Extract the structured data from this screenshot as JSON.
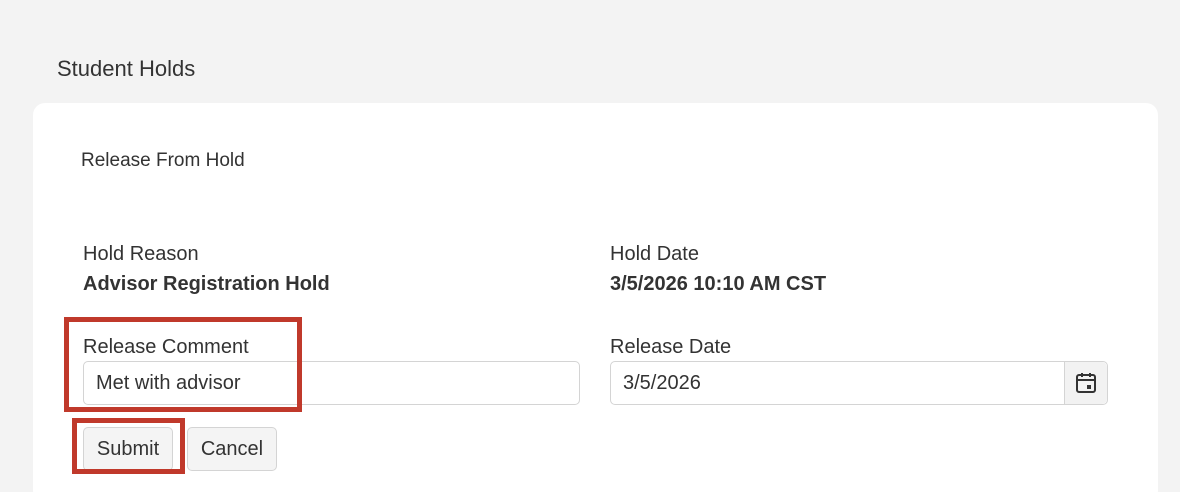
{
  "page": {
    "title": "Student Holds"
  },
  "form": {
    "section_title": "Release From Hold",
    "hold_reason": {
      "label": "Hold Reason",
      "value": "Advisor Registration Hold"
    },
    "hold_date": {
      "label": "Hold Date",
      "value": "3/5/2026 10:10 AM CST"
    },
    "release_comment": {
      "label": "Release Comment",
      "value": "Met with advisor"
    },
    "release_date": {
      "label": "Release Date",
      "value": "3/5/2026",
      "icon": "calendar-icon"
    }
  },
  "actions": {
    "submit_label": "Submit",
    "cancel_label": "Cancel"
  },
  "colors": {
    "highlight": "#c0392b",
    "background": "#f3f3f3",
    "card": "#ffffff"
  }
}
